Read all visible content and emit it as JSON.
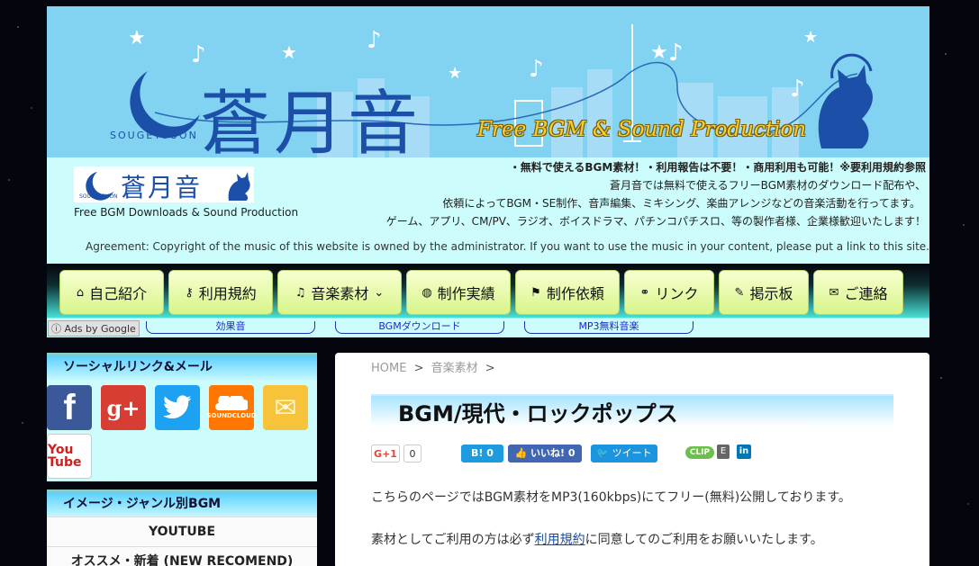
{
  "banner": {
    "title": "蒼月音",
    "romaji": "SOUGETSUON",
    "subtitle": "Free BGM & Sound Production"
  },
  "header": {
    "logo_text": "蒼月音",
    "logo_romaji": "SOUGETSUON",
    "tagline": "Free BGM Downloads & Sound Production",
    "info_lines": [
      "・無料で使えるBGM素材！・利用報告は不要！・商用利用も可能！※要利用規約参照",
      "蒼月音では無料で使えるフリーBGM素材のダウンロード配布や、",
      "依頼によってBGM・SE制作、音声編集、ミキシング、楽曲アレンジなどの音楽活動を行ってます。",
      "ゲーム、アプリ、CM/PV、ラジオ、ボイスドラマ、パチンコパチスロ、等の製作者様、企業様歓迎いたします！"
    ],
    "agreement": "Agreement: Copyright of the music of this website is owned by the administrator. If you want to use the music in your content, please put a link to this site."
  },
  "nav": [
    {
      "label": "自己紹介",
      "icon": "home-icon",
      "glyph": "⌂"
    },
    {
      "label": "利用規約",
      "icon": "key-icon",
      "glyph": "⚷"
    },
    {
      "label": "音楽素材",
      "icon": "music-icon",
      "glyph": "♫",
      "dropdown": "⌄"
    },
    {
      "label": "制作実績",
      "icon": "works-icon",
      "glyph": "◍"
    },
    {
      "label": "制作依頼",
      "icon": "flag-icon",
      "glyph": "⚑"
    },
    {
      "label": "リンク",
      "icon": "link-icon",
      "glyph": "⚭"
    },
    {
      "label": "掲示板",
      "icon": "comment-icon",
      "glyph": "✎"
    },
    {
      "label": "ご連絡",
      "icon": "mail-icon",
      "glyph": "✉"
    }
  ],
  "ads": {
    "label": "ⓘ Ads by Google",
    "links": [
      "効果音",
      "BGMダウンロード",
      "MP3無料音楽"
    ]
  },
  "sidebar": {
    "social_title": "ソーシャルリンク&メール",
    "social": [
      {
        "name": "facebook-icon",
        "text": "f",
        "color": "#3b5998"
      },
      {
        "name": "googleplus-icon",
        "text": "g+",
        "color": "#d73d32"
      },
      {
        "name": "twitter-icon",
        "text": "t",
        "color": "#1da1f2"
      },
      {
        "name": "soundcloud-icon",
        "text": "SOUNDCLOUD",
        "color": "#ff7700"
      },
      {
        "name": "mail-icon",
        "text": "✉",
        "color": "#f0b000"
      },
      {
        "name": "youtube-icon",
        "text": "You Tube",
        "color": "#cc2020"
      }
    ],
    "genre_title": "イメージ・ジャンル別BGM",
    "genre_items": [
      "YOUTUBE",
      "オススメ・新着 (NEW RECOMEND)"
    ]
  },
  "main": {
    "breadcrumb": [
      "HOME",
      ">",
      "音楽素材",
      ">"
    ],
    "title": "BGM/現代・ロックポップス",
    "share": {
      "gplus": "G+1",
      "gplus_count": "0",
      "hatena": "B! 0",
      "like": "いいね! 0",
      "tweet": "ツイート",
      "clip": "CLIP"
    },
    "para1": "こちらのページではBGM素材をMP3(160kbps)にてフリー(無料)公開しております。",
    "para2_pre": "素材としてご利用の方は必ず",
    "para2_link": "利用規約",
    "para2_post": "に同意してのご利用をお願いいたします。"
  },
  "colors": {
    "banner_bg": "#82d2f2",
    "info_bg": "#ccfcfb",
    "nav_btn": "#e6f9a8",
    "brand_blue": "#1b4fa8",
    "subtitle_gold": "#f4cd3a"
  }
}
